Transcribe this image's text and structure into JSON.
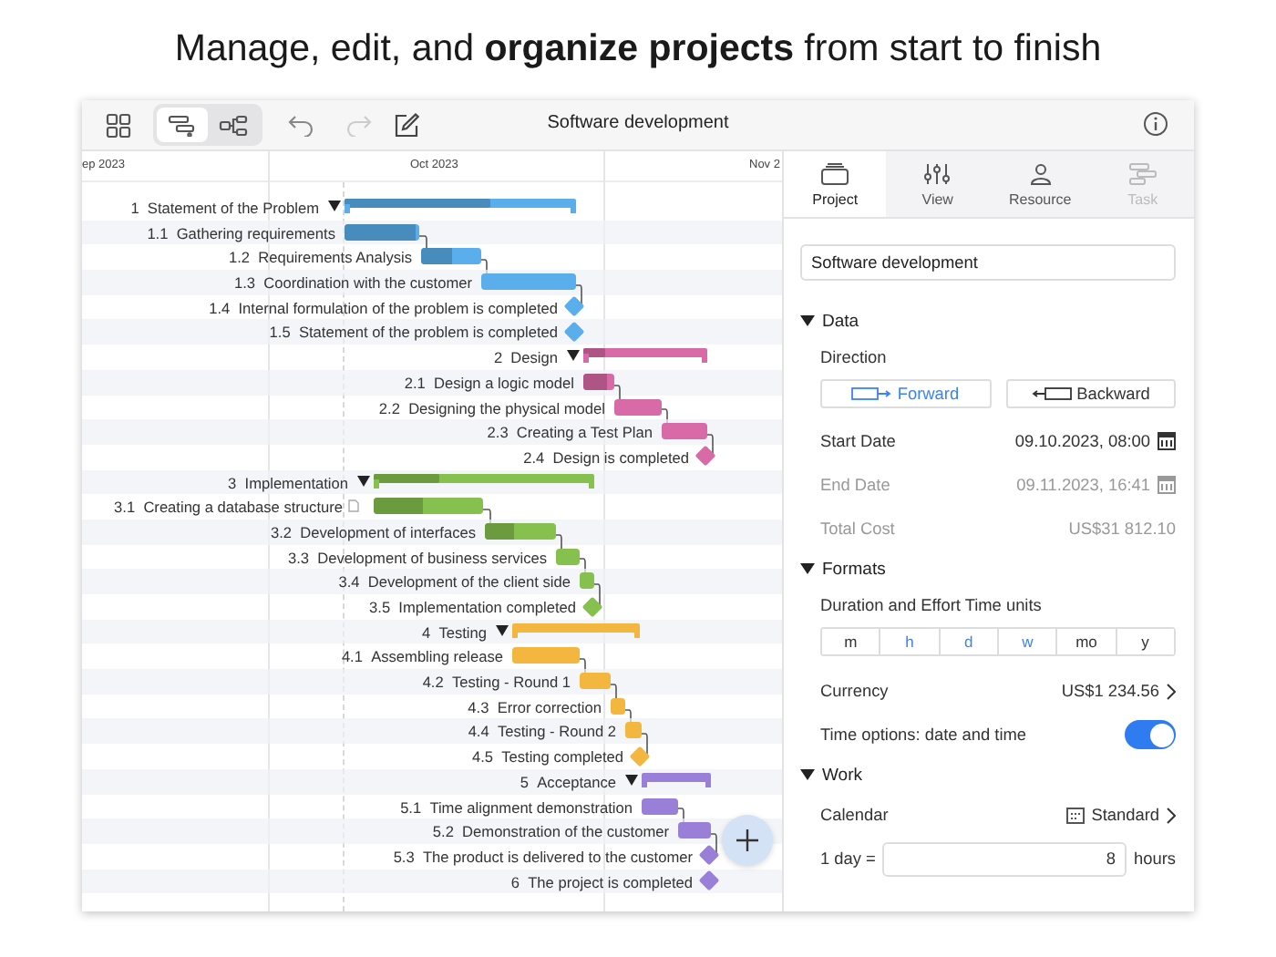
{
  "headline": "Manage, edit, and **organize projects** from start to finish",
  "toolbar": {
    "title": "Software development",
    "view_modes": [
      {
        "kind": "gantt",
        "selected": true
      },
      {
        "kind": "network",
        "selected": false
      }
    ],
    "undo": {
      "disabled": false
    },
    "redo": {
      "disabled": true
    }
  },
  "timeline": {
    "months": [
      "ep 2023",
      "Oct 2023",
      "Nov 2"
    ]
  },
  "tasks": [
    {
      "number": "1",
      "name": "Statement of the Problem",
      "kind": "summary",
      "expanded": true,
      "color": "#5aaeec",
      "level": 0.63
    },
    {
      "number": "1.1",
      "name": "Gathering requirements",
      "kind": "task",
      "color": "#5aaeec",
      "level": 0.95
    },
    {
      "number": "1.2",
      "name": "Requirements Analysis",
      "kind": "task",
      "color": "#5aaeec",
      "level": 0.5
    },
    {
      "number": "1.3",
      "name": "Coordination with the customer",
      "kind": "task",
      "color": "#5aaeec"
    },
    {
      "number": "1.4",
      "name": "Internal formulation of the problem is completed",
      "kind": "milestone",
      "color": "#5aaeec"
    },
    {
      "number": "1.5",
      "name": "Statement of the problem is completed",
      "kind": "milestone",
      "color": "#5aaeec"
    },
    {
      "number": "2",
      "name": "Design",
      "kind": "summary",
      "expanded": true,
      "color": "#d96aa8",
      "level": 0.18
    },
    {
      "number": "2.1",
      "name": "Design a logic model",
      "kind": "task",
      "color": "#d96aa8",
      "level": 0.75
    },
    {
      "number": "2.2",
      "name": "Designing the physical model",
      "kind": "task",
      "color": "#d96aa8"
    },
    {
      "number": "2.3",
      "name": "Creating a Test Plan",
      "kind": "task",
      "color": "#d96aa8"
    },
    {
      "number": "2.4",
      "name": "Design is completed",
      "kind": "milestone",
      "color": "#d96aa8"
    },
    {
      "number": "3",
      "name": "Implementation",
      "kind": "summary",
      "expanded": true,
      "color": "#86c04f",
      "level": 0.3
    },
    {
      "number": "3.1",
      "name": "Creating a database structure",
      "kind": "task",
      "color": "#86c04f",
      "level": 0.45,
      "has_note": true
    },
    {
      "number": "3.2",
      "name": "Development of interfaces",
      "kind": "task",
      "color": "#86c04f",
      "level": 0.4
    },
    {
      "number": "3.3",
      "name": "Development of business services",
      "kind": "task",
      "color": "#86c04f"
    },
    {
      "number": "3.4",
      "name": "Development of the client side",
      "kind": "task",
      "color": "#86c04f"
    },
    {
      "number": "3.5",
      "name": "Implementation completed",
      "kind": "milestone",
      "color": "#86c04f"
    },
    {
      "number": "4",
      "name": "Testing",
      "kind": "summary",
      "expanded": true,
      "color": "#f3b63e"
    },
    {
      "number": "4.1",
      "name": "Assembling release",
      "kind": "task",
      "color": "#f3b63e"
    },
    {
      "number": "4.2",
      "name": "Testing - Round 1",
      "kind": "task",
      "color": "#f3b63e"
    },
    {
      "number": "4.3",
      "name": "Error correction",
      "kind": "task",
      "color": "#f3b63e"
    },
    {
      "number": "4.4",
      "name": "Testing - Round 2",
      "kind": "task",
      "color": "#f3b63e"
    },
    {
      "number": "4.5",
      "name": "Testing completed",
      "kind": "milestone",
      "color": "#f3b63e"
    },
    {
      "number": "5",
      "name": "Acceptance",
      "kind": "summary",
      "expanded": true,
      "color": "#9a7fd8"
    },
    {
      "number": "5.1",
      "name": "Time alignment demonstration",
      "kind": "task",
      "color": "#9a7fd8"
    },
    {
      "number": "5.2",
      "name": "Demonstration of the customer",
      "kind": "task",
      "color": "#9a7fd8"
    },
    {
      "number": "5.3",
      "name": "The product is delivered to the customer",
      "kind": "milestone",
      "color": "#9a7fd8"
    },
    {
      "number": "6",
      "name": "The project is completed",
      "kind": "milestone",
      "color": "#9a7fd8"
    }
  ],
  "inspector": {
    "tabs": [
      {
        "label": "Project",
        "kind": "project",
        "selected": true,
        "disabled": false
      },
      {
        "label": "View",
        "kind": "view",
        "selected": false,
        "disabled": false
      },
      {
        "label": "Resource",
        "kind": "resource",
        "selected": false,
        "disabled": false
      },
      {
        "label": "Task",
        "kind": "task",
        "selected": false,
        "disabled": true
      }
    ],
    "project_name": "Software development",
    "data": {
      "title": "Data",
      "expanded": true,
      "direction_label": "Direction",
      "directions": [
        {
          "label": "Forward",
          "kind": "forward",
          "selected": true
        },
        {
          "label": "Backward",
          "kind": "backward",
          "selected": false
        }
      ],
      "fields": [
        {
          "label": "Start Date",
          "value": "09.10.2023, 08:00",
          "kind": "date",
          "disabled": false
        },
        {
          "label": "End Date",
          "value": "09.11.2023, 16:41",
          "kind": "date",
          "disabled": true
        },
        {
          "label": "Total Cost",
          "value": "US$31 812.10",
          "kind": "text",
          "disabled": true
        }
      ]
    },
    "formats": {
      "title": "Formats",
      "expanded": true,
      "units_label": "Duration and Effort Time units",
      "units": [
        {
          "label": "m",
          "selected": false
        },
        {
          "label": "h",
          "selected": true
        },
        {
          "label": "d",
          "selected": true
        },
        {
          "label": "w",
          "selected": true
        },
        {
          "label": "mo",
          "selected": false
        },
        {
          "label": "y",
          "selected": false
        }
      ],
      "currency": {
        "label": "Currency",
        "value": "US$1 234.56"
      },
      "time_options": {
        "label": "Time options: date and time",
        "on": true
      }
    },
    "work": {
      "title": "Work",
      "expanded": true,
      "calendar": {
        "label": "Calendar",
        "value": "Standard"
      },
      "day": {
        "label": "1 day =",
        "value": "8",
        "unit": "hours"
      }
    }
  }
}
